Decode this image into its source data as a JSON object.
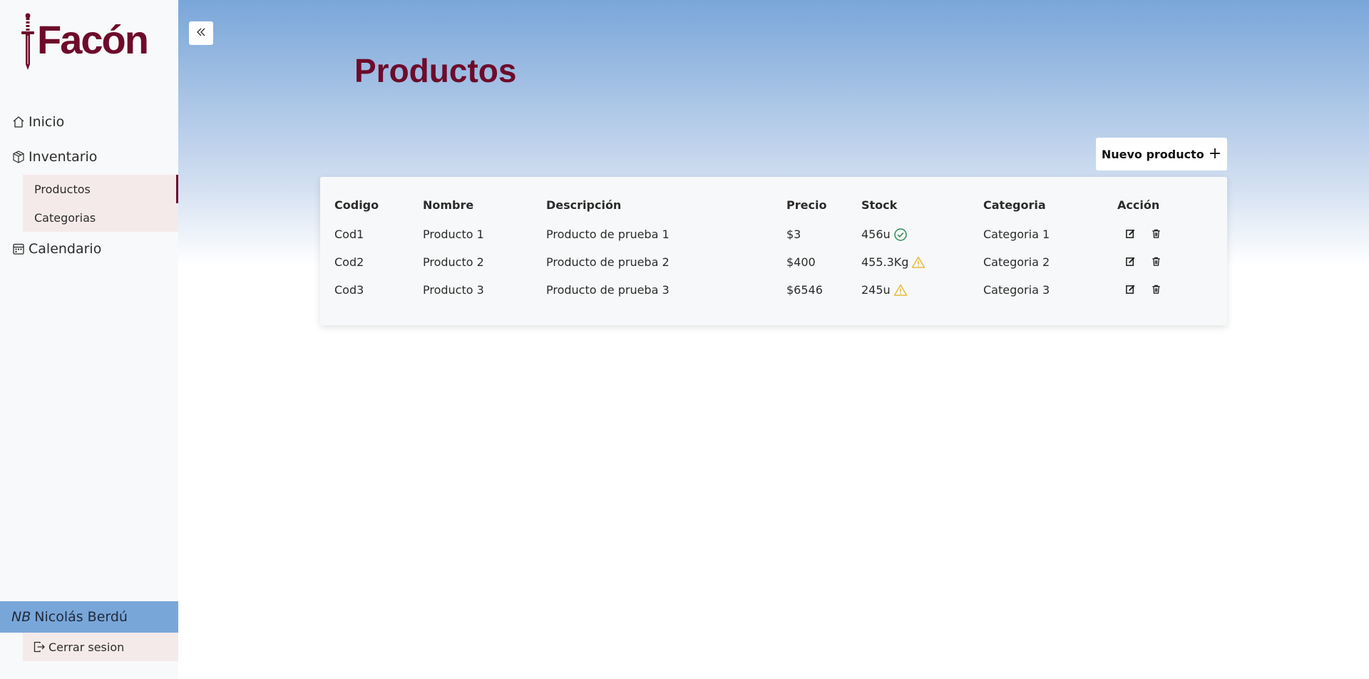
{
  "brand": {
    "name": "Facón",
    "color": "#6e0b2b"
  },
  "sidebar": {
    "nav": {
      "inicio": {
        "label": "Inicio",
        "icon": "home-icon"
      },
      "inventario": {
        "label": "Inventario",
        "icon": "box-icon",
        "children": [
          {
            "label": "Productos",
            "active": true
          },
          {
            "label": "Categorias",
            "active": false
          }
        ]
      },
      "calendario": {
        "label": "Calendario",
        "icon": "calendar-icon"
      }
    },
    "user": {
      "initials": "NB",
      "name": "Nicolás Berdú"
    },
    "logout": {
      "label": "Cerrar sesion",
      "icon": "logout-icon"
    }
  },
  "page": {
    "title": "Productos",
    "new_button": {
      "label": "Nuevo producto",
      "icon": "plus-icon"
    }
  },
  "table": {
    "headers": {
      "codigo": "Codigo",
      "nombre": "Nombre",
      "descripcion": "Descripción",
      "precio": "Precio",
      "stock": "Stock",
      "categoria": "Categoria",
      "accion": "Acción"
    },
    "rows": [
      {
        "codigo": "Cod1",
        "nombre": "Producto 1",
        "descripcion": "Producto de prueba 1",
        "precio": "$3",
        "stock": "456u",
        "stock_status": "ok",
        "categoria": "Categoria 1"
      },
      {
        "codigo": "Cod2",
        "nombre": "Producto 2",
        "descripcion": "Producto de prueba 2",
        "precio": "$400",
        "stock": "455.3Kg",
        "stock_status": "warning",
        "categoria": "Categoria 2"
      },
      {
        "codigo": "Cod3",
        "nombre": "Producto 3",
        "descripcion": "Producto de prueba 3",
        "precio": "$6546",
        "stock": "245u",
        "stock_status": "warning",
        "categoria": "Categoria 3"
      }
    ]
  },
  "colors": {
    "ok": "#2e8b57",
    "warning": "#e8b93c",
    "user_bar": "#79a6d9",
    "subnav_bg": "#f5eaea"
  }
}
